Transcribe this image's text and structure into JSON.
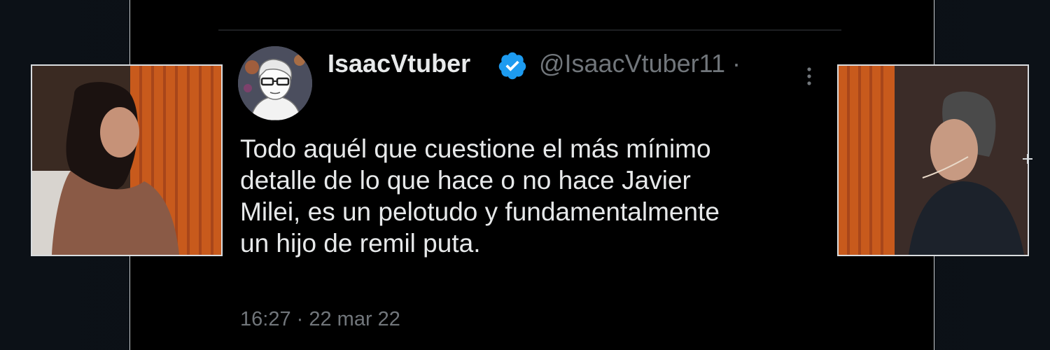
{
  "tweet": {
    "display_name": "IsaacVtuber",
    "handle": "@IsaacVtuber11 ·",
    "text_lines": [
      "Todo aquél que cuestione el más mínimo",
      "detalle de lo que hace o no hace Javier",
      "Milei, es un pelotudo y fundamentalmente",
      "un hijo de remil puta."
    ],
    "timestamp": "16:27 · 22 mar 22"
  },
  "icons": {
    "verified": "verified-badge-icon",
    "more": "more-options-icon",
    "plus": "plus-icon"
  },
  "colors": {
    "background": "#000000",
    "primary_text": "#e7e9ea",
    "secondary_text": "#71767b",
    "verified_blue": "#1d9bf0",
    "curtain_orange": "#c85a1c"
  }
}
